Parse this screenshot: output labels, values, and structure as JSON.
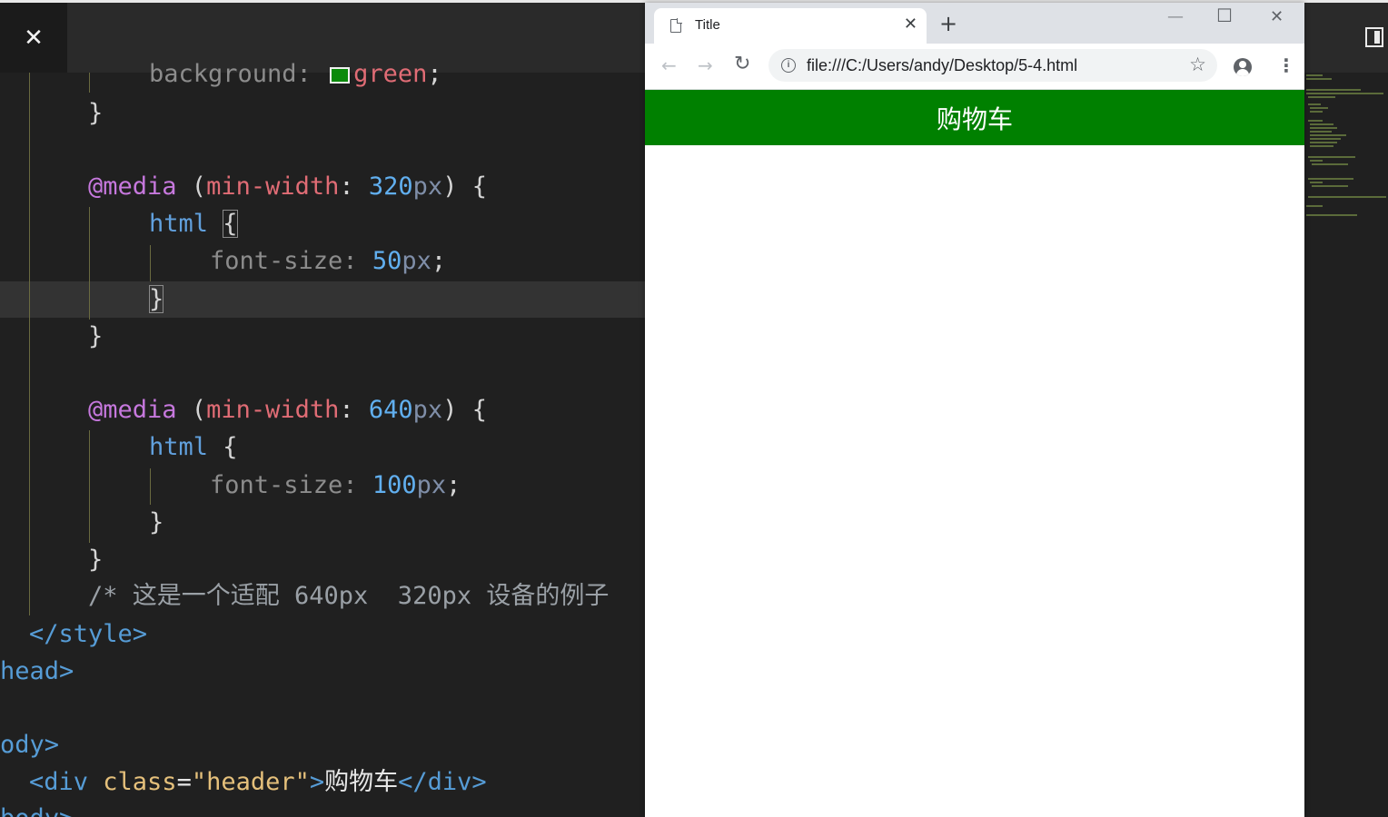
{
  "editor": {
    "close_glyph": "✕",
    "lines": {
      "l0a": "background:",
      "l0b": "green",
      "l0c": ";",
      "l1": "}",
      "m1_at": "@media",
      "m1_open": " (",
      "m1_prop": "min-width",
      "m1_colon": ": ",
      "m1_num": "320",
      "m1_unit": "px",
      "m1_close": ") {",
      "h1_sel": "html",
      "h1_brace": "{",
      "f1_prop": "font-size",
      "f1_colon": ": ",
      "f1_num": "50",
      "f1_unit": "px",
      "f1_semi": ";",
      "c1": "}",
      "c2": "}",
      "m2_at": "@media",
      "m2_open": " (",
      "m2_prop": "min-width",
      "m2_colon": ": ",
      "m2_num": "640",
      "m2_unit": "px",
      "m2_close": ") {",
      "h2_sel": "html",
      "h2_brace": " {",
      "f2_prop": "font-size",
      "f2_colon": ": ",
      "f2_num": "100",
      "f2_unit": "px",
      "f2_semi": ";",
      "c3": "}",
      "c4": "}",
      "comment": "/* 这是一个适配 640px  320px 设备的例子",
      "style_close": "</style>",
      "head_close": "head>",
      "body_open": "ody>",
      "div_open_a": "<div ",
      "div_attr": "class",
      "div_eq": "=",
      "div_str": "\"header\"",
      "div_gt": ">",
      "div_text": "购物车",
      "div_close": "</div>",
      "body_close": "body>"
    }
  },
  "browser": {
    "tab_title": "Title",
    "tab_close": "✕",
    "new_tab": "+",
    "window_minimize": "—",
    "window_maximize": "☐",
    "window_close": "✕",
    "back": "←",
    "forward": "→",
    "reload": "↻",
    "info_glyph": "i",
    "url": "file:///C:/Users/andy/Desktop/5-4.html",
    "star": "☆",
    "menu": "⋮",
    "page": {
      "header_text": "购物车",
      "header_color": "#008000"
    }
  }
}
